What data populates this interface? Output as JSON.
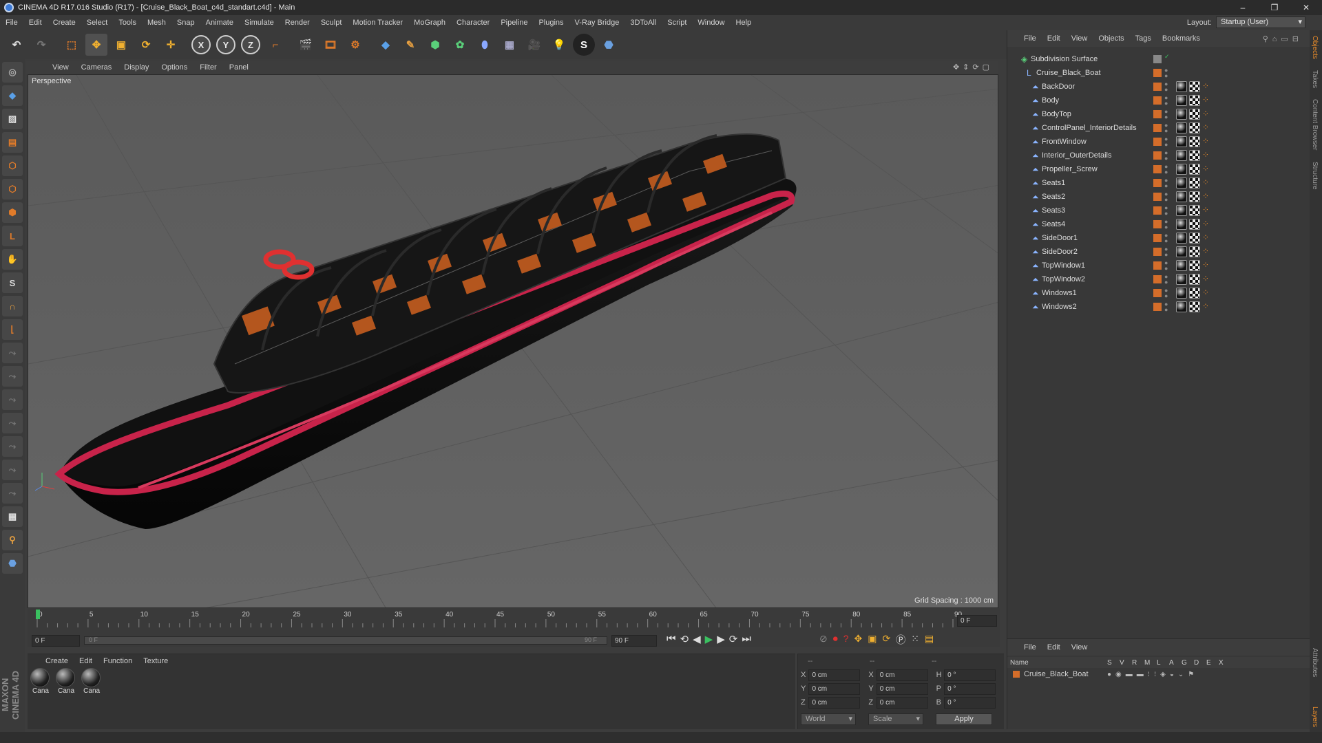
{
  "window": {
    "title": "CINEMA 4D R17.016 Studio (R17) - [Cruise_Black_Boat_c4d_standart.c4d] - Main",
    "controls": [
      "–",
      "❐",
      "✕"
    ]
  },
  "menubar": [
    "File",
    "Edit",
    "Create",
    "Select",
    "Tools",
    "Mesh",
    "Snap",
    "Animate",
    "Simulate",
    "Render",
    "Sculpt",
    "Motion Tracker",
    "MoGraph",
    "Character",
    "Pipeline",
    "Plugins",
    "V-Ray Bridge",
    "3DToAll",
    "Script",
    "Window",
    "Help"
  ],
  "layout": {
    "label": "Layout:",
    "value": "Startup (User)"
  },
  "toolbar": {
    "axis_x": "X",
    "axis_y": "Y",
    "axis_z": "Z"
  },
  "viewport": {
    "menu": [
      "View",
      "Cameras",
      "Display",
      "Options",
      "Filter",
      "Panel"
    ],
    "label": "Perspective",
    "grid_spacing": "Grid Spacing : 1000 cm"
  },
  "timeline": {
    "ticks": [
      "0",
      "5",
      "10",
      "15",
      "20",
      "25",
      "30",
      "35",
      "40",
      "45",
      "50",
      "55",
      "60",
      "65",
      "70",
      "75",
      "80",
      "85",
      "90"
    ],
    "current_frame": "0 F",
    "start_field": "0 F",
    "range_start": "0 F",
    "range_end": "90 F",
    "end_field": "90 F"
  },
  "material_manager": {
    "menu": [
      "Create",
      "Edit",
      "Function",
      "Texture"
    ],
    "materials": [
      "Cana",
      "Cana",
      "Cana"
    ]
  },
  "coordinates": {
    "header_left": "--",
    "header_mid": "--",
    "header_right": "--",
    "rows": [
      {
        "a1": "X",
        "v1": "0 cm",
        "a2": "X",
        "v2": "0 cm",
        "a3": "H",
        "v3": "0 °"
      },
      {
        "a1": "Y",
        "v1": "0 cm",
        "a2": "Y",
        "v2": "0 cm",
        "a3": "P",
        "v3": "0 °"
      },
      {
        "a1": "Z",
        "v1": "0 cm",
        "a2": "Z",
        "v2": "0 cm",
        "a3": "B",
        "v3": "0 °"
      }
    ],
    "mode": "World",
    "type": "Scale",
    "apply": "Apply"
  },
  "object_manager": {
    "menu": [
      "File",
      "Edit",
      "View",
      "Objects",
      "Tags",
      "Bookmarks"
    ],
    "root": "Subdivision Surface",
    "group": "Cruise_Black_Boat",
    "objects": [
      "BackDoor",
      "Body",
      "BodyTop",
      "ControlPanel_InteriorDetails",
      "FrontWindow",
      "Interior_OuterDetails",
      "Propeller_Screw",
      "Seats1",
      "Seats2",
      "Seats3",
      "Seats4",
      "SideDoor1",
      "SideDoor2",
      "TopWindow1",
      "TopWindow2",
      "Windows1",
      "Windows2"
    ]
  },
  "attributes": {
    "menu": [
      "File",
      "Edit",
      "View"
    ],
    "columns": {
      "name": "Name",
      "cols": [
        "S",
        "V",
        "R",
        "M",
        "L",
        "A",
        "G",
        "D",
        "E",
        "X"
      ]
    },
    "row": "Cruise_Black_Boat"
  },
  "side_tabs": [
    "Objects",
    "Takes",
    "Content Browser",
    "Structure"
  ],
  "side_tabs_bottom": [
    "Attributes",
    "Layers"
  ],
  "colors": {
    "accent_orange": "#d46d2a",
    "hull_red": "#c8234a",
    "bg": "#3c3c3c",
    "viewport": "#5e5e5e"
  }
}
